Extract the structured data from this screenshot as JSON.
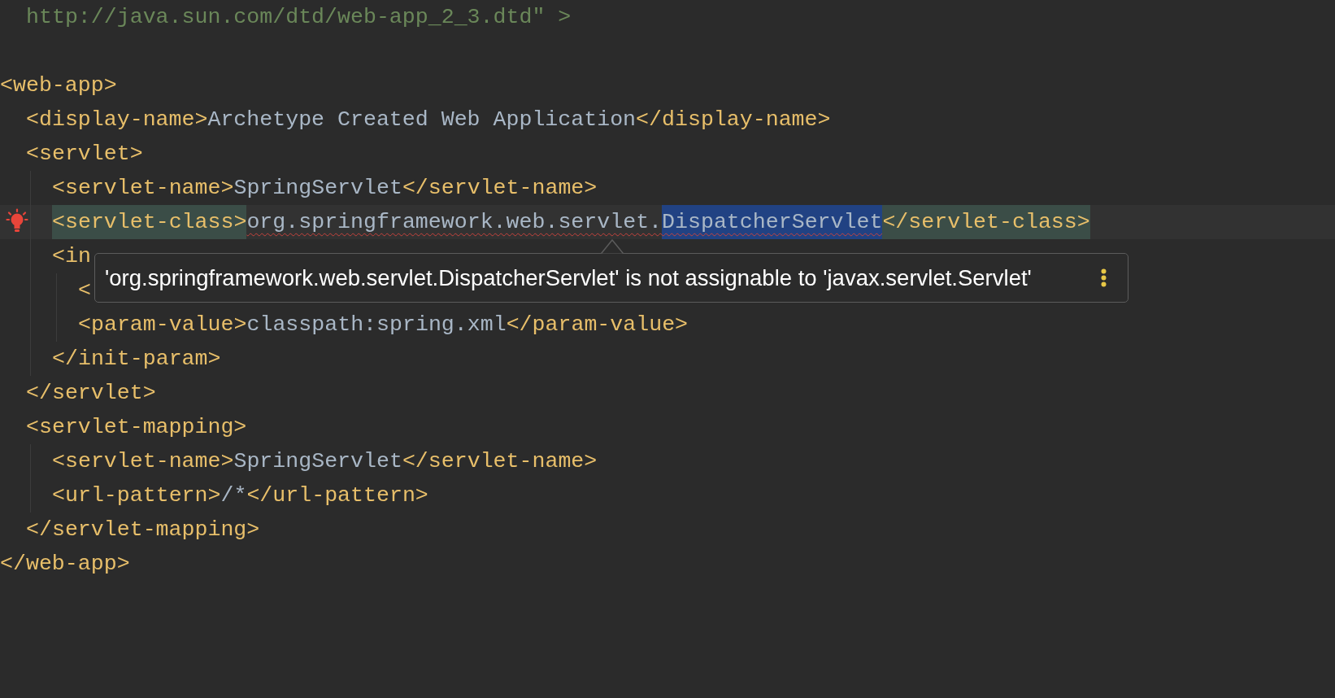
{
  "editor": {
    "lines": [
      {
        "kind": "code",
        "children": [
          {
            "kind": "code",
            "segments": [
              {
                "kind": "string",
                "text": "http://java.sun.com/dtd/web-app_2_3.dtd\" >"
              }
            ]
          }
        ]
      },
      {
        "kind": "blank"
      },
      {
        "kind": "code",
        "segments": [
          {
            "kind": "tag",
            "text": "<web-app>"
          }
        ],
        "children": [
          {
            "kind": "code",
            "segments": [
              {
                "kind": "tag",
                "text": "<display-name>"
              },
              {
                "kind": "text",
                "text": "Archetype Created Web Application"
              },
              {
                "kind": "tag",
                "text": "</display-name>"
              }
            ]
          },
          {
            "kind": "code",
            "segments": [
              {
                "kind": "tag",
                "text": "<servlet>"
              }
            ],
            "children": [
              {
                "kind": "code",
                "segments": [
                  {
                    "kind": "tag",
                    "text": "<servlet-name>"
                  },
                  {
                    "kind": "text",
                    "text": "SpringServlet"
                  },
                  {
                    "kind": "tag",
                    "text": "</servlet-name>"
                  }
                ]
              },
              {
                "kind": "code",
                "current": true,
                "bulb": true,
                "segments": [
                  {
                    "kind": "tag",
                    "text": "<servlet-class>",
                    "matched": true,
                    "error": false,
                    "selected": false
                  },
                  {
                    "kind": "text",
                    "text": "org.springframework.web.servlet.",
                    "matched": false,
                    "error": true,
                    "selected": false
                  },
                  {
                    "kind": "text",
                    "text": "DispatcherServlet",
                    "matched": false,
                    "error": true,
                    "selected": true
                  },
                  {
                    "kind": "tag",
                    "text": "</servlet-class>",
                    "matched": true,
                    "error": false,
                    "selected": false
                  }
                ]
              },
              {
                "kind": "code",
                "segments": [
                  {
                    "kind": "tag",
                    "text": "<in"
                  }
                ],
                "children": [
                  {
                    "kind": "code",
                    "segments": [
                      {
                        "kind": "tag",
                        "text": "<"
                      }
                    ]
                  },
                  {
                    "kind": "code",
                    "segments": [
                      {
                        "kind": "tag",
                        "text": "<param-value>"
                      },
                      {
                        "kind": "text",
                        "text": "classpath:spring.xml"
                      },
                      {
                        "kind": "tag",
                        "text": "</param-value>"
                      }
                    ]
                  }
                ]
              },
              {
                "kind": "code",
                "segments": [
                  {
                    "kind": "tag",
                    "text": "</init-param>"
                  }
                ]
              }
            ]
          },
          {
            "kind": "code",
            "segments": [
              {
                "kind": "tag",
                "text": "</servlet>"
              }
            ]
          },
          {
            "kind": "code",
            "segments": [
              {
                "kind": "tag",
                "text": "<servlet-mapping>"
              }
            ],
            "children": [
              {
                "kind": "code",
                "segments": [
                  {
                    "kind": "tag",
                    "text": "<servlet-name>"
                  },
                  {
                    "kind": "text",
                    "text": "SpringServlet"
                  },
                  {
                    "kind": "tag",
                    "text": "</servlet-name>"
                  }
                ]
              },
              {
                "kind": "code",
                "segments": [
                  {
                    "kind": "tag",
                    "text": "<url-pattern>"
                  },
                  {
                    "kind": "text",
                    "text": "/*"
                  },
                  {
                    "kind": "tag",
                    "text": "</url-pattern>"
                  }
                ]
              }
            ]
          },
          {
            "kind": "code",
            "segments": [
              {
                "kind": "tag",
                "text": "</servlet-mapping>"
              }
            ]
          }
        ]
      },
      {
        "kind": "code",
        "segments": [
          {
            "kind": "tag",
            "text": "</web-app>"
          }
        ]
      }
    ]
  },
  "tooltip": {
    "message": "'org.springframework.web.servlet.DispatcherServlet' is not assignable to 'javax.servlet.Servlet'"
  }
}
